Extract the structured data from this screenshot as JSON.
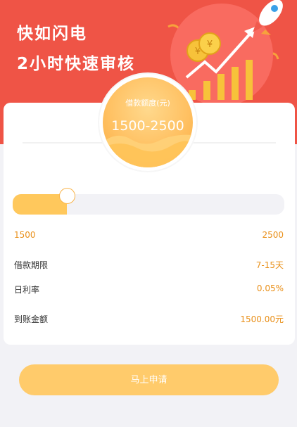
{
  "hero": {
    "title": "快如闪电",
    "subtitle": "2小时快速审核",
    "colors": {
      "background": "#ef5446",
      "coin": "#f7c23a",
      "bars": "#f7c23a"
    },
    "art_icons": [
      "rocket-icon",
      "coin-icon",
      "growth-arrow-icon",
      "bar-chart-icon"
    ]
  },
  "loan_badge": {
    "label": "借款额度(元)",
    "value": "1500-2500"
  },
  "slider": {
    "min_label": "1500",
    "max_label": "2500",
    "fill_fraction": 0.2,
    "colors": {
      "fill": "#ffc85c",
      "track": "#f2f2f6"
    }
  },
  "details": [
    {
      "label": "借款期限",
      "value": "7-15天"
    },
    {
      "label": "日利率",
      "value": "0.05%"
    },
    {
      "label": "到账金额",
      "value": "1500.00元"
    }
  ],
  "apply_button": {
    "label": "马上申请",
    "color": "#ffcb6b"
  }
}
